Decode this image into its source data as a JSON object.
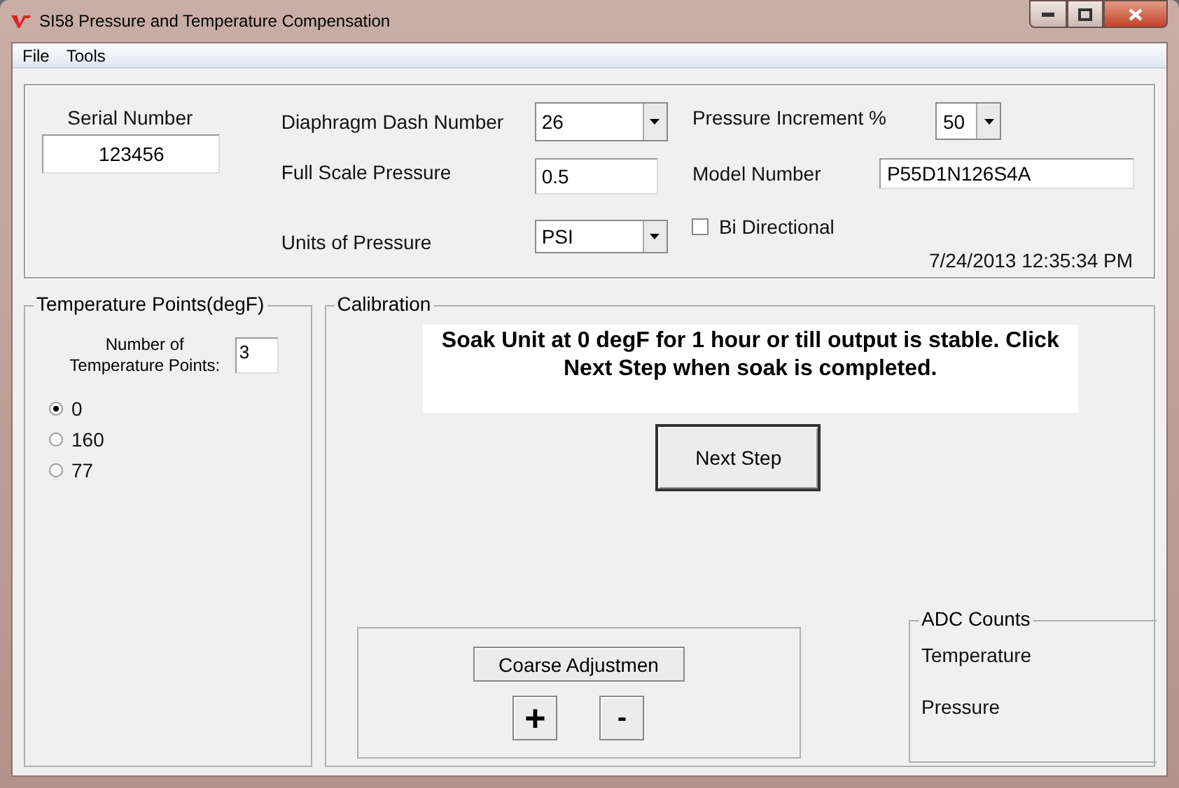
{
  "window": {
    "title": "SI58 Pressure and Temperature Compensation"
  },
  "menu": [
    "File",
    "Tools"
  ],
  "header": {
    "serial_number": {
      "label": "Serial Number",
      "value": "123456"
    },
    "diaphragm_dash_number": {
      "label": "Diaphragm Dash Number",
      "value": "26"
    },
    "full_scale_pressure": {
      "label": "Full Scale Pressure",
      "value": "0.5"
    },
    "units_of_pressure": {
      "label": "Units of Pressure",
      "value": "PSI"
    },
    "pressure_increment": {
      "label": "Pressure Increment %",
      "value": "50"
    },
    "model_number": {
      "label": "Model Number",
      "value": "P55D1N126S4A"
    },
    "bi_directional": {
      "label": "Bi Directional",
      "checked": false
    },
    "timestamp": "7/24/2013 12:35:34 PM"
  },
  "temperature_points": {
    "title": "Temperature Points(degF)",
    "count_label": "Number of Temperature Points:",
    "count": "3",
    "options": [
      {
        "label": "0",
        "selected": true
      },
      {
        "label": "160",
        "selected": false
      },
      {
        "label": "77",
        "selected": false
      }
    ]
  },
  "calibration": {
    "title": "Calibration",
    "message": "Soak Unit at 0 degF for 1 hour or till output is stable. Click Next Step when soak is completed.",
    "next_button": "Next Step"
  },
  "adjustment": {
    "button": "Coarse Adjustmen",
    "plus": "+",
    "minus": "-"
  },
  "adc_counts": {
    "title": "ADC Counts",
    "labels": [
      "Temperature",
      "Pressure"
    ]
  }
}
